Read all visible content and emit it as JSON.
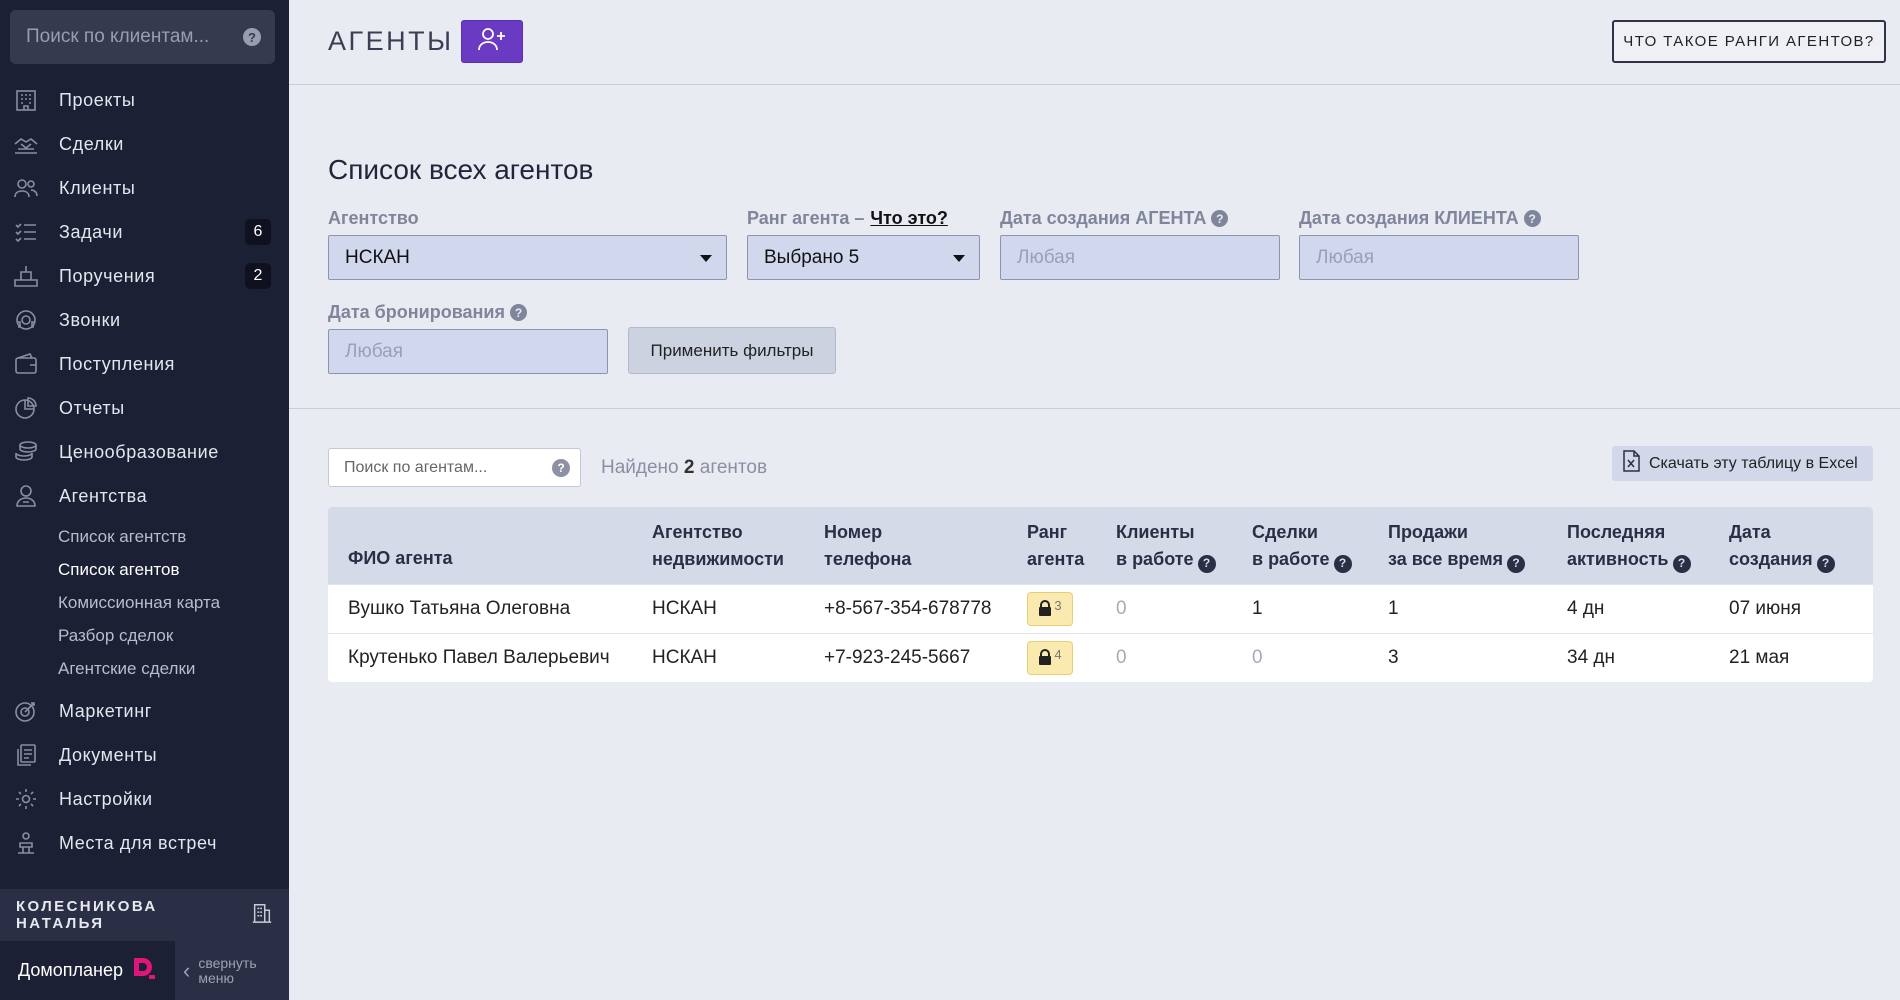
{
  "sidebar": {
    "search_placeholder": "Поиск по клиентам...",
    "nav": [
      {
        "label": "Проекты",
        "icon": "building-icon"
      },
      {
        "label": "Сделки",
        "icon": "deal-icon"
      },
      {
        "label": "Клиенты",
        "icon": "clients-icon"
      },
      {
        "label": "Задачи",
        "icon": "tasks-icon",
        "badge": "6"
      },
      {
        "label": "Поручения",
        "icon": "assignments-icon",
        "badge": "2"
      },
      {
        "label": "Звонки",
        "icon": "headset-icon"
      },
      {
        "label": "Поступления",
        "icon": "wallet-icon"
      },
      {
        "label": "Отчеты",
        "icon": "pie-chart-icon"
      },
      {
        "label": "Ценообразование",
        "icon": "coins-icon"
      },
      {
        "label": "Агентства",
        "icon": "agency-icon"
      }
    ],
    "subnav": [
      {
        "label": "Список агентств"
      },
      {
        "label": "Список агентов",
        "active": true
      },
      {
        "label": "Комиссионная карта"
      },
      {
        "label": "Разбор сделок"
      },
      {
        "label": "Агентские сделки"
      }
    ],
    "nav2": [
      {
        "label": "Маркетинг",
        "icon": "target-icon"
      },
      {
        "label": "Документы",
        "icon": "documents-icon"
      },
      {
        "label": "Настройки",
        "icon": "gear-icon"
      },
      {
        "label": "Места для встреч",
        "icon": "meeting-icon"
      }
    ],
    "user_name": "КОЛЕСНИКОВА НАТАЛЬЯ",
    "brand": "Домопланер",
    "collapse_label": "свернуть меню"
  },
  "header": {
    "title": "АГЕНТЫ",
    "ranks_button": "ЧТО ТАКОЕ РАНГИ АГЕНТОВ?"
  },
  "filters": {
    "section_title": "Список всех агентов",
    "agency_label": "Агентство",
    "agency_value": "НСКАН",
    "rank_label": "Ранг агента –",
    "rank_what": "Что это?",
    "rank_value": "Выбрано 5",
    "agent_date_label": "Дата создания АГЕНТА",
    "agent_date_placeholder": "Любая",
    "client_date_label": "Дата создания КЛИЕНТА",
    "client_date_placeholder": "Любая",
    "booking_date_label": "Дата бронирования",
    "booking_date_placeholder": "Любая",
    "apply_button": "Применить фильтры"
  },
  "list": {
    "search_placeholder": "Поиск по агентам...",
    "found_prefix": "Найдено",
    "found_count": "2",
    "found_suffix": "агентов",
    "excel_button": "Скачать эту таблицу в Excel"
  },
  "table": {
    "headers": {
      "name": "ФИО агента",
      "agency_1": "Агентство",
      "agency_2": "недвижимости",
      "phone_1": "Номер",
      "phone_2": "телефона",
      "rank_1": "Ранг",
      "rank_2": "агента",
      "clients_1": "Клиенты",
      "clients_2": "в работе",
      "deals_1": "Сделки",
      "deals_2": "в работе",
      "sales_1": "Продажи",
      "sales_2": "за все время",
      "activity_1": "Последняя",
      "activity_2": "активность",
      "created_1": "Дата",
      "created_2": "создания"
    },
    "rows": [
      {
        "name": "Вушко Татьяна Олеговна",
        "agency": "НСКАН",
        "phone": "+8-567-354-678778",
        "rank": "3",
        "clients": "0",
        "deals": "1",
        "sales": "1",
        "activity": "4 дн",
        "created": "07 июня"
      },
      {
        "name": "Крутенько Павел Валерьевич",
        "agency": "НСКАН",
        "phone": "+7-923-245-5667",
        "rank": "4",
        "clients": "0",
        "deals": "0",
        "sales": "3",
        "activity": "34 дн",
        "created": "21 мая"
      }
    ]
  }
}
